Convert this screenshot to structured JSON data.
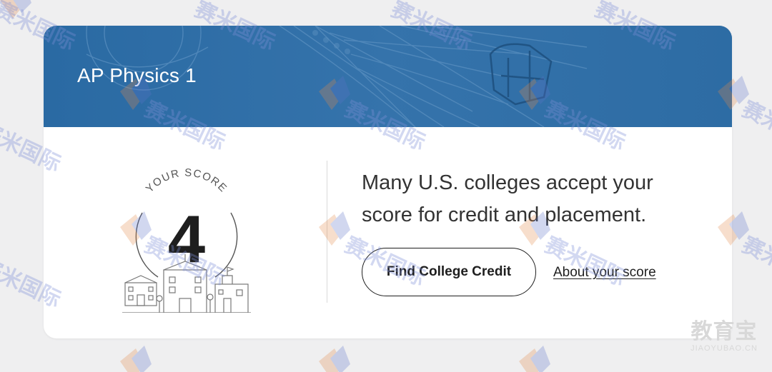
{
  "card": {
    "title": "AP Physics 1",
    "score": {
      "label": "YOUR SCORE",
      "value": "4"
    },
    "message": "Many U.S. colleges accept your score for credit and placement.",
    "primary_button_label": "Find College Credit",
    "secondary_link_label": "About your score"
  },
  "colors": {
    "header": "#2d6ca4",
    "text": "#1e1e1e",
    "background": "#efeff0"
  },
  "watermark": {
    "text": "赛米国际"
  },
  "footer_logo": {
    "cn": "教育宝",
    "en": "JIAOYUBAO.CN"
  }
}
